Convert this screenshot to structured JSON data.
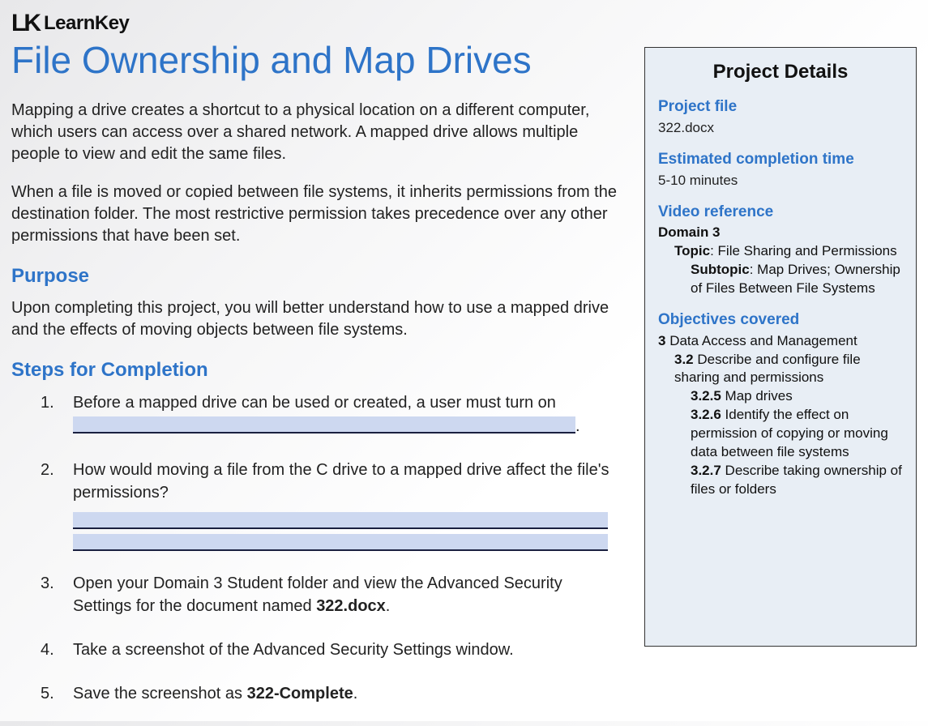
{
  "brand": {
    "mark": "LK",
    "name": "LearnKey"
  },
  "title": "File Ownership and Map Drives",
  "intro_paragraphs": [
    "Mapping a drive creates a shortcut to a physical location on a different computer, which users can access over a shared network. A mapped drive allows multiple people to view and edit the same files.",
    "When a file is moved or copied between file systems, it inherits permissions from the destination folder. The most restrictive permission takes precedence over any other permissions that have been set."
  ],
  "sections": {
    "purpose_heading": "Purpose",
    "purpose_text": "Upon completing this project, you will better understand how to use a mapped drive and the effects of moving objects between file systems.",
    "steps_heading": "Steps for Completion"
  },
  "steps": {
    "s1_prefix": "Before a mapped drive can be used or created, a user must turn on ",
    "s1_suffix_after_blank": ".",
    "s2_text": "How would moving a file from the C drive to a mapped drive affect the file's permissions?",
    "s3_prefix": "Open your Domain 3 Student folder and view the Advanced Security Settings for the document named ",
    "s3_bold": "322.docx",
    "s3_suffix": ".",
    "s4_text": "Take a screenshot of the Advanced Security Settings window.",
    "s5_prefix": "Save the screenshot as ",
    "s5_bold": "322-Complete",
    "s5_suffix": "."
  },
  "sidebar": {
    "panel_title": "Project Details",
    "project_file_label": "Project file",
    "project_file_value": "322.docx",
    "time_label": "Estimated completion time",
    "time_value": "5-10 minutes",
    "video_label": "Video reference",
    "video": {
      "domain": "Domain 3",
      "topic_label": "Topic",
      "topic_value": "File Sharing and Permissions",
      "subtopic_label": "Subtopic",
      "subtopic_value": "Map Drives; Ownership of Files Between File Systems"
    },
    "objectives_label": "Objectives covered",
    "objectives": {
      "root_num": "3",
      "root_text": "Data Access and Management",
      "lvl2_num": "3.2",
      "lvl2_text": "Describe and configure file sharing and permissions",
      "items": [
        {
          "num": "3.2.5",
          "text": "Map drives"
        },
        {
          "num": "3.2.6",
          "text": "Identify the effect on permission of copying or moving data between file systems"
        },
        {
          "num": "3.2.7",
          "text": "Describe taking ownership of files or folders"
        }
      ]
    }
  }
}
